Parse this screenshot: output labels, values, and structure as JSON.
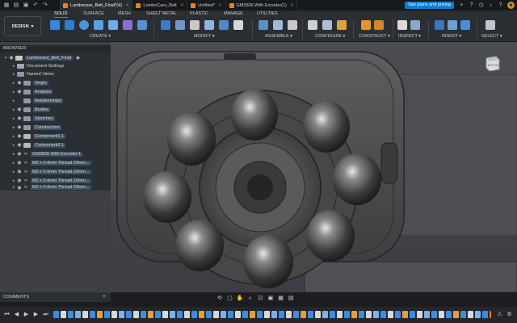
{
  "tabs": [
    {
      "label": "Lumbocare_Belt_Final*(4)",
      "active": true
    },
    {
      "label": "LumboCare_Belt",
      "active": false
    },
    {
      "label": "Untitled*",
      "active": false
    },
    {
      "label": "GM3506 With Encoder(1)",
      "active": false
    }
  ],
  "header": {
    "plans_button": "See plans and pricing"
  },
  "toolbar": {
    "workspace": "DESIGN",
    "workspace_tabs": [
      "SOLID",
      "SURFACE",
      "MESH",
      "SHEET METAL",
      "PLASTIC",
      "MANAGE",
      "UTILITIES"
    ],
    "groups": [
      "CREATE",
      "MODIFY",
      "ASSEMBLE",
      "CONFIGURE",
      "CONSTRUCT",
      "INSPECT",
      "INSERT",
      "SELECT"
    ]
  },
  "browser": {
    "title": "BROWSER",
    "root": "Lumbocare_Belt_Final",
    "items": [
      "Document Settings",
      "Named Views",
      "Origin",
      "Analysis",
      "Relationships",
      "Bodies",
      "Sketches",
      "Construction",
      "Component1:1",
      "Component2:1",
      "GM3506 With Encoder:1",
      "M2 x 0.4mm Thread 20mm...",
      "M2 x 0.4mm Thread 20mm...",
      "M2 x 0.4mm Thread 20mm...",
      "M2 x 0.4mm Thread 20mm..."
    ]
  },
  "comments": {
    "label": "COMMENTS"
  },
  "viewcube": {
    "label": "BOTTOM"
  },
  "colors": {
    "accent": "#0a7fd3",
    "tab_icon": "#e8821c",
    "selection": "#3b4f63"
  }
}
